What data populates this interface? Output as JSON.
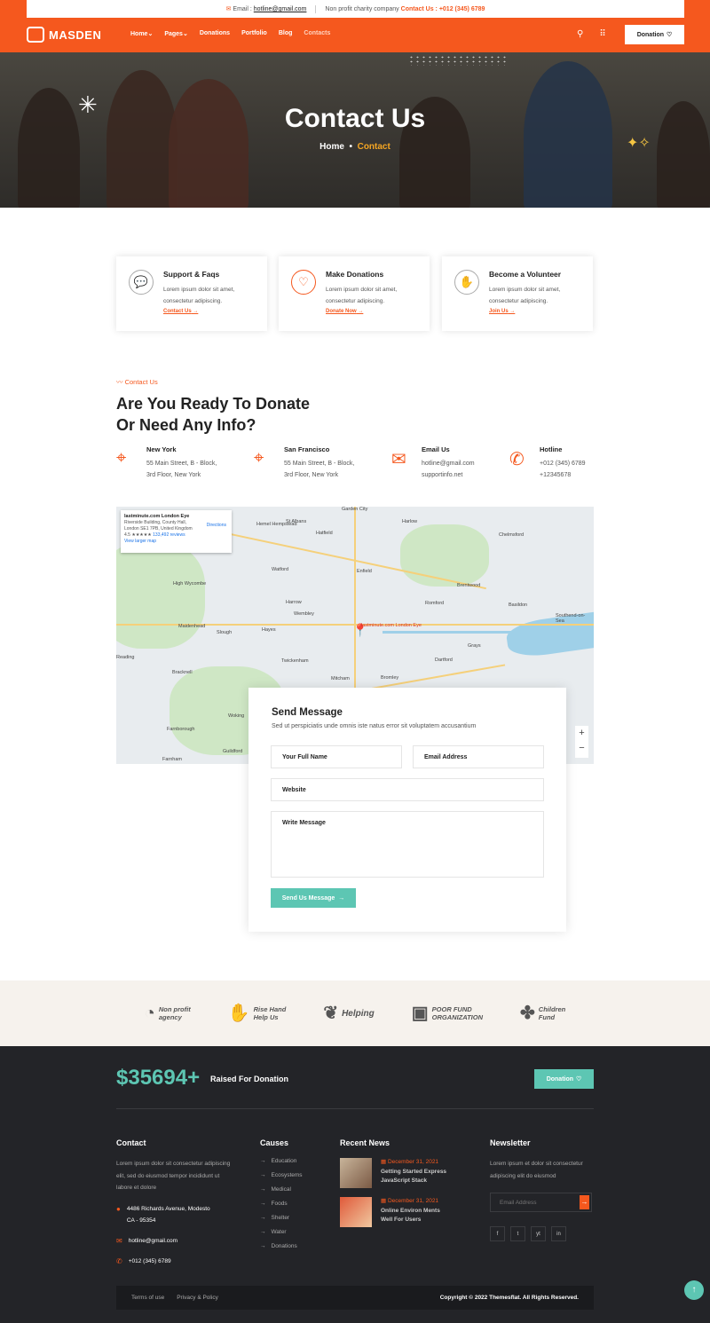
{
  "topbar": {
    "email_label": "Email :",
    "email": "hotline@gmail.com",
    "tagline": "Non profit charity company",
    "contact_label": "Contact Us :",
    "phone": "+012 (345) 6789"
  },
  "brand": {
    "name": "MASDEN",
    "accent": "#f5581e",
    "teal": "#5dc6b3"
  },
  "nav": {
    "items": [
      "Home",
      "Pages",
      "Donations",
      "Portfolio",
      "Blog",
      "Contacts"
    ],
    "donation_button": "Donation"
  },
  "hero": {
    "title": "Contact Us",
    "crumb_home": "Home",
    "crumb_current": "Contact"
  },
  "cards": [
    {
      "title": "Support & Faqs",
      "text1": "Lorem ipsum dolor sit amet,",
      "text2": "consectetur adipiscing.",
      "link": "Contact Us",
      "icon": "chat-icon"
    },
    {
      "title": "Make Donations",
      "text1": "Lorem ipsum dolor sit amet,",
      "text2": "consectetur adipiscing.",
      "link": "Donate Now",
      "icon": "heart-hands-icon"
    },
    {
      "title": "Become a Volunteer",
      "text1": "Lorem ipsum dolor sit amet,",
      "text2": "consectetur adipiscing.",
      "link": "Join Us",
      "icon": "handshake-icon"
    }
  ],
  "contact": {
    "sublabel": "Contact Us",
    "heading1": "Are You Ready To Donate",
    "heading2": "Or Need Any Info?",
    "info": [
      {
        "title": "New York",
        "l1": "55 Main Street, B - Block,",
        "l2": "3rd Floor, New York"
      },
      {
        "title": "San Francisco",
        "l1": "55 Main Street, B - Block,",
        "l2": "3rd Floor, New York"
      },
      {
        "title": "Email Us",
        "l1": "hotline@gmail.com",
        "l2": "supportinfo.net"
      },
      {
        "title": "Hotline",
        "l1": "+012 (345) 6789",
        "l2": "+12345678"
      }
    ]
  },
  "map": {
    "place": "lastminute.com London Eye",
    "address1": "Riverside Building, County Hall,",
    "address2": "London SE1 7PB, United Kingdom",
    "rating": "4.5 ★★★★★",
    "reviews": "133,492 reviews",
    "larger": "View larger map",
    "directions": "Directions",
    "pin_label": "lastminute.com London Eye",
    "cities": [
      "Garden City",
      "Harlow",
      "St Albans",
      "Hatfield",
      "Hemel Hempstead",
      "Chelmsford",
      "Brentwood",
      "Watford",
      "Enfield",
      "Romford",
      "Basildon",
      "Southend-on-Sea",
      "High Wycombe",
      "Harrow",
      "Wembley",
      "Maidenhead",
      "Slough",
      "Hayes",
      "Dartford",
      "Grays",
      "Bracknell",
      "Twickenham",
      "Bromley",
      "Mitcham",
      "Farnborough",
      "Guildford",
      "Woking",
      "Farnham",
      "Reading"
    ]
  },
  "form": {
    "title": "Send Message",
    "desc": "Sed ut perspiciatis unde omnis iste natus error sit voluptatem accusantium",
    "name_ph": "Your Full Name",
    "email_ph": "Email Address",
    "website_ph": "Website",
    "message_ph": "Write Message",
    "submit": "Send Us Message"
  },
  "partners": [
    {
      "l1": "Non profit",
      "l2": "agency"
    },
    {
      "l1": "Rise Hand",
      "l2": "Help Us"
    },
    {
      "l1": "Helping",
      "l2": ""
    },
    {
      "l1": "POOR FUND",
      "l2": "ORGANIZATION"
    },
    {
      "l1": "Children",
      "l2": "Fund"
    }
  ],
  "footer": {
    "raised": "$35694+",
    "raised_label": "Raised For Donation",
    "donation_button": "Donation",
    "contact_title": "Contact",
    "contact_text": "Lorem ipsum dolor sit consectetur adipiscing elit, sed do eiusmod tempor incididunt ut labore et dolore",
    "address1": "4486 Richards Avenue, Modesto",
    "address2": "CA - 95354",
    "email": "hotline@gmail.com",
    "phone": "+012 (345) 6789",
    "causes_title": "Causes",
    "causes": [
      "Education",
      "Ecosystems",
      "Medical",
      "Foods",
      "Shelter",
      "Water",
      "Donations"
    ],
    "news_title": "Recent News",
    "news": [
      {
        "date": "December 31, 2021",
        "title1": "Getting Started Express",
        "title2": "JavaScript Stack"
      },
      {
        "date": "December 31, 2021",
        "title1": "Online Environ Ments",
        "title2": "Well For Users"
      }
    ],
    "newsletter_title": "Newsletter",
    "newsletter_text": "Lorem ipsum et dolor sit consectetur adipiscing elit do eiusmod",
    "newsletter_ph": "Email Address",
    "socials": [
      "f",
      "t",
      "yt",
      "in"
    ],
    "terms": "Terms of use",
    "privacy": "Privacy & Policy",
    "copyright": "Copyright © 2022 Themesflat. All Rights Reserved."
  }
}
